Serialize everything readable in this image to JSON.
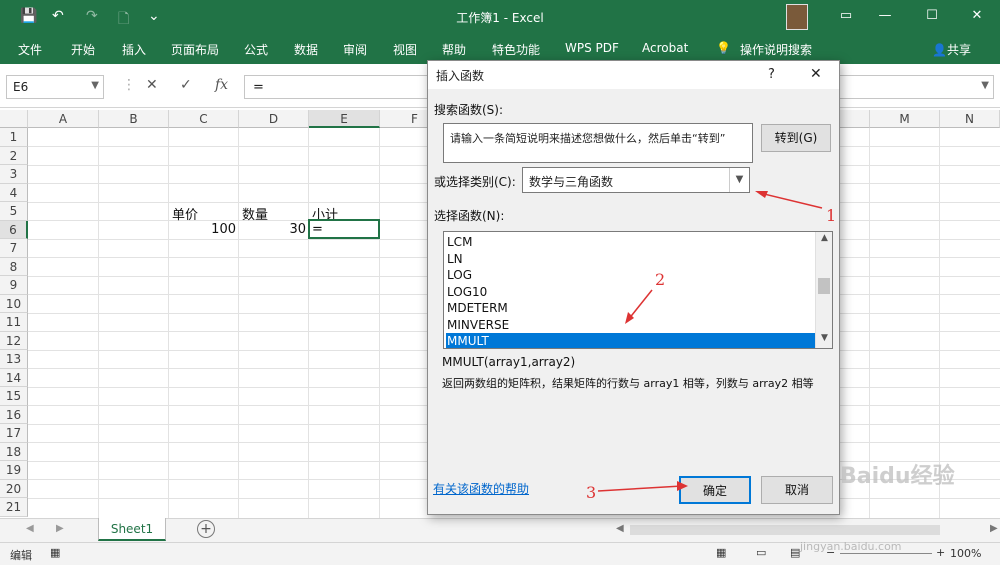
{
  "titlebar": {
    "title": "工作簿1 - Excel",
    "save_icon": "💾",
    "undo_icon": "↶",
    "redo_icon": "↷",
    "new_icon": "🗋",
    "more_icon": "⌄"
  },
  "ribbon": {
    "tabs": [
      "文件",
      "开始",
      "插入",
      "页面布局",
      "公式",
      "数据",
      "审阅",
      "视图",
      "帮助",
      "特色功能",
      "WPS PDF",
      "Acrobat",
      "操作说明搜索"
    ],
    "share_label": "共享"
  },
  "formula_bar": {
    "name_box": "E6",
    "formula": "=",
    "cancel": "✕",
    "enter": "✓",
    "fx": "fx"
  },
  "grid": {
    "columns": [
      "A",
      "B",
      "C",
      "D",
      "E",
      "F",
      "M",
      "N"
    ],
    "rows": [
      "1",
      "2",
      "3",
      "4",
      "5",
      "6",
      "7",
      "8",
      "9",
      "10",
      "11",
      "12",
      "13",
      "14",
      "15",
      "16",
      "17",
      "18",
      "19",
      "20",
      "21"
    ],
    "cells": {
      "C5": "单价",
      "D5": "数量",
      "E5": "小计",
      "C6": "100",
      "D6": "30",
      "E6": "="
    }
  },
  "sheets": {
    "active": "Sheet1",
    "add": "+"
  },
  "status": {
    "mode": "编辑",
    "zoom": "100%"
  },
  "dialog": {
    "title": "插入函数",
    "help_btn": "?",
    "close_btn": "✕",
    "search_label": "搜索函数(S):",
    "search_placeholder": "请输入一条简短说明来描述您想做什么，然后单击“转到”",
    "goto_btn": "转到(G)",
    "category_label": "或选择类别(C):",
    "category_value": "数学与三角函数",
    "select_label": "选择函数(N):",
    "functions": [
      "LCM",
      "LN",
      "LOG",
      "LOG10",
      "MDETERM",
      "MINVERSE",
      "MMULT"
    ],
    "selected_function": "MMULT",
    "signature": "MMULT(array1,array2)",
    "description": "返回两数组的矩阵积，结果矩阵的行数与 array1 相等，列数与 array2 相等",
    "help_link": "有关该函数的帮助",
    "ok_btn": "确定",
    "cancel_btn": "取消"
  },
  "annotations": {
    "n1": "1",
    "n2": "2",
    "n3": "3",
    "color": "#dd3333"
  },
  "watermark": {
    "brand": "Baidu经验",
    "url": "jingyan.baidu.com"
  }
}
